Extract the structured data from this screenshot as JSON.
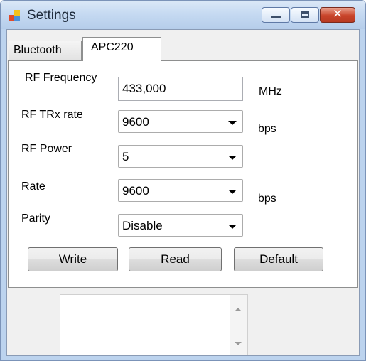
{
  "window": {
    "title": "Settings",
    "close_glyph": "✕"
  },
  "tabs": [
    {
      "label": "Bluetooth",
      "selected": false
    },
    {
      "label": "APC220",
      "selected": true
    }
  ],
  "form": {
    "rf_frequency": {
      "label": "RF Frequency",
      "value": "433,000",
      "unit": "MHz"
    },
    "rf_trx_rate": {
      "label": "RF TRx rate",
      "value": "9600",
      "unit": "bps"
    },
    "rf_power": {
      "label": "RF Power",
      "value": "5"
    },
    "rate": {
      "label": "Rate",
      "value": "9600",
      "unit": "bps"
    },
    "parity": {
      "label": "Parity",
      "value": "Disable"
    }
  },
  "buttons": {
    "write": "Write",
    "read": "Read",
    "default": "Default"
  },
  "colors": {
    "title_bar": "#c6daf2",
    "close_button": "#c8442a"
  }
}
